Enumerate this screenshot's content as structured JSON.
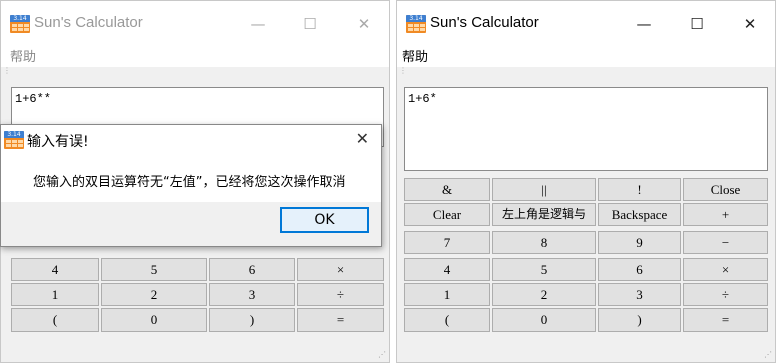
{
  "left_window": {
    "title": "Sun's Calculator",
    "icon_text": "3.14",
    "titlebar": {
      "minimize": "—",
      "maximize": "☐",
      "close": "✕"
    },
    "menu_help": "帮助",
    "display": "1+6**",
    "buttons": [
      [
        "4",
        "5",
        "6",
        "×"
      ],
      [
        "1",
        "2",
        "3",
        "÷"
      ],
      [
        "(",
        "0",
        ")",
        "="
      ]
    ]
  },
  "dialog": {
    "icon_text": "3.14",
    "title": "输入有误!",
    "close": "✕",
    "message": "您输入的双目运算符无“左值”，已经将您这次操作取消",
    "ok_label": "OK"
  },
  "right_window": {
    "title": "Sun's Calculator",
    "icon_text": "3.14",
    "titlebar": {
      "minimize": "—",
      "maximize": "☐",
      "close": "✕"
    },
    "menu_help": "帮助",
    "display": "1+6*",
    "buttons": [
      [
        "&",
        "||",
        "!",
        "Close"
      ],
      [
        "Clear",
        "左上角是逻辑与",
        "Backspace",
        "+"
      ],
      [
        "7",
        "8",
        "9",
        "−"
      ],
      [
        "4",
        "5",
        "6",
        "×"
      ],
      [
        "1",
        "2",
        "3",
        "÷"
      ],
      [
        "(",
        "0",
        ")",
        "="
      ]
    ]
  },
  "colors": {
    "window_bg": "#f0f0f0",
    "accent": "#0078d7",
    "button_bg": "#e1e1e1"
  }
}
